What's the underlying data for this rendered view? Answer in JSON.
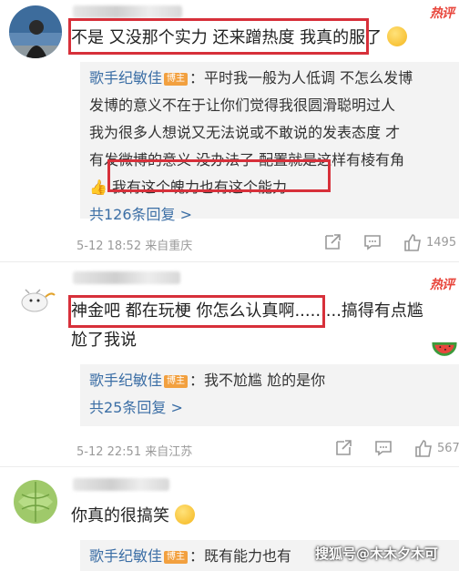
{
  "comments": [
    {
      "hot_label": "热评",
      "text_lines": [
        "不是 又没那个实力 还来蹭热度 我真的服了"
      ],
      "reply": {
        "author": "歌手纪敏佳",
        "tag": "博主",
        "lines": [
          "：平时我一般为人低调 不怎么发博",
          "发博的意义不在于让你们觉得我很圆滑聪明过人",
          "我为很多人想说又无法说或不敢说的发表态度 才",
          "有发微博的意义 没办法了 配置就是这样有棱有角",
          "我有这个魄力也有这个能力"
        ],
        "count": "共126条回复 >"
      },
      "meta": {
        "time": "5-12 18:52 来自重庆",
        "likes": "1495"
      }
    },
    {
      "hot_label": "热评",
      "text_lines": [
        "神金吧 都在玩梗 你怎么认真啊.........搞得有点尴",
        "尬了我说"
      ],
      "reply": {
        "author": "歌手纪敏佳",
        "tag": "博主",
        "lines": [
          "：我不尬尴 尬的是你"
        ],
        "count": "共25条回复 >"
      },
      "meta": {
        "time": "5-12 22:51 来自江苏",
        "likes": "567"
      }
    },
    {
      "text_lines": [
        "你真的很搞笑"
      ],
      "reply": {
        "author": "歌手纪敏佳",
        "tag": "博主",
        "lines": [
          "：既有能力也有"
        ]
      }
    }
  ],
  "watermark": "搜狐号@木木夕木可",
  "colors": {
    "highlight_box": "#d7303a",
    "author_link": "#3b6ea5",
    "hot": "#e8463c",
    "reply_bg": "#f3f3f3"
  }
}
